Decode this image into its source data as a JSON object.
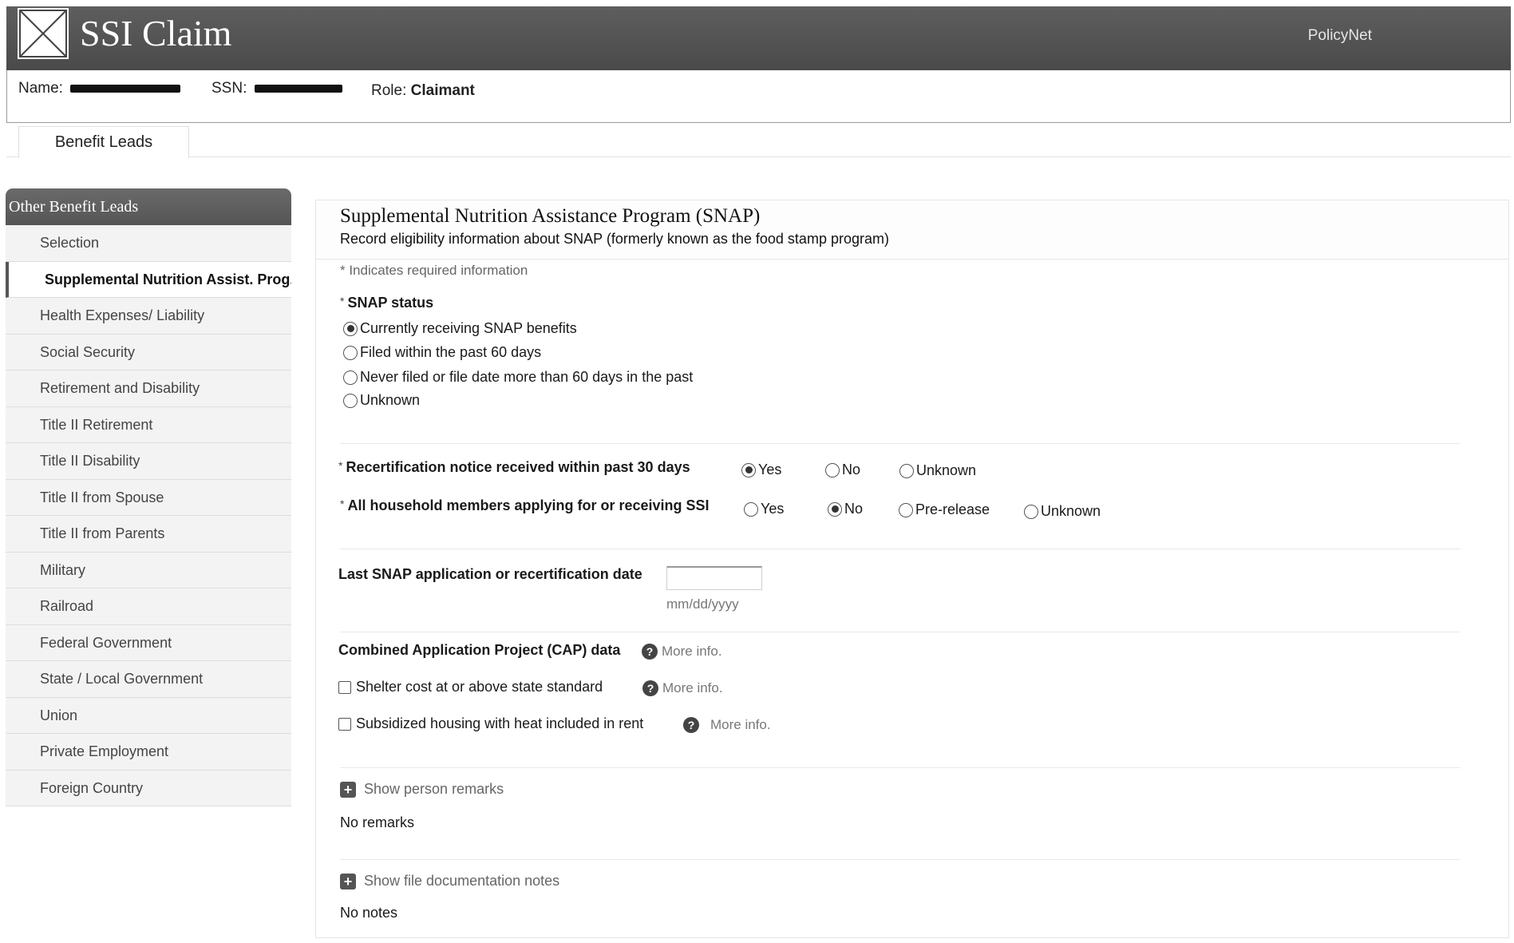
{
  "app": {
    "title": "SSI Claim",
    "link": "PolicyNet",
    "logo_icon": "broken-image-icon"
  },
  "claimant": {
    "name_label": "Name:",
    "ssn_label": "SSN:",
    "role_label": "Role:",
    "role_value": "Claimant"
  },
  "tabs": [
    {
      "label": "Benefit Leads",
      "active": true
    }
  ],
  "sidebar": {
    "heading": "Other Benefit Leads",
    "items": [
      {
        "label": "Selection"
      },
      {
        "label": "Supplemental Nutrition Assist. Prog.",
        "active": true
      },
      {
        "label": "Health Expenses/ Liability"
      },
      {
        "label": "Social Security"
      },
      {
        "label": "Retirement and Disability"
      },
      {
        "label": "Title II Retirement"
      },
      {
        "label": "Title II Disability"
      },
      {
        "label": "Title II from Spouse"
      },
      {
        "label": "Title II from Parents"
      },
      {
        "label": "Military"
      },
      {
        "label": "Railroad"
      },
      {
        "label": "Federal Government"
      },
      {
        "label": "State / Local Government"
      },
      {
        "label": "Union"
      },
      {
        "label": "Private Employment"
      },
      {
        "label": "Foreign Country"
      }
    ]
  },
  "main": {
    "title": "Supplemental Nutrition Assistance Program (SNAP)",
    "subtitle": "Record eligibility information about SNAP (formerly known as the food stamp program)",
    "required_note": "* Indicates required information",
    "snap_status": {
      "label": "SNAP status",
      "options": [
        {
          "label": "Currently receiving SNAP benefits",
          "selected": true
        },
        {
          "label": "Filed within the past 60 days",
          "selected": false
        },
        {
          "label": "Never filed or file date more than 60 days in the past",
          "selected": false
        },
        {
          "label": "Unknown",
          "selected": false
        }
      ]
    },
    "recert_notice": {
      "label": "Recertification notice received within past 30 days",
      "options": [
        {
          "label": "Yes",
          "selected": true
        },
        {
          "label": "No",
          "selected": false
        },
        {
          "label": "Unknown",
          "selected": false
        }
      ]
    },
    "household": {
      "label": "All household members applying for or receiving SSI",
      "options": [
        {
          "label": "Yes",
          "selected": false
        },
        {
          "label": "No",
          "selected": true
        },
        {
          "label": "Pre-release",
          "selected": false
        },
        {
          "label": "Unknown",
          "selected": false
        }
      ]
    },
    "last_date": {
      "label": "Last SNAP application or recertification date",
      "value": "",
      "hint": "mm/dd/yyyy"
    },
    "cap": {
      "label": "Combined Application Project (CAP) data",
      "more_info": "More info.",
      "shelter": {
        "label": "Shelter cost at or above state standard",
        "checked": false,
        "more_info": "More info."
      },
      "housing": {
        "label": "Subsidized housing with heat included in rent",
        "checked": false,
        "more_info": "More info."
      }
    },
    "remarks": {
      "toggle": "Show person remarks",
      "value": "No remarks"
    },
    "notes": {
      "toggle": "Show file documentation notes",
      "value": "No notes"
    }
  }
}
